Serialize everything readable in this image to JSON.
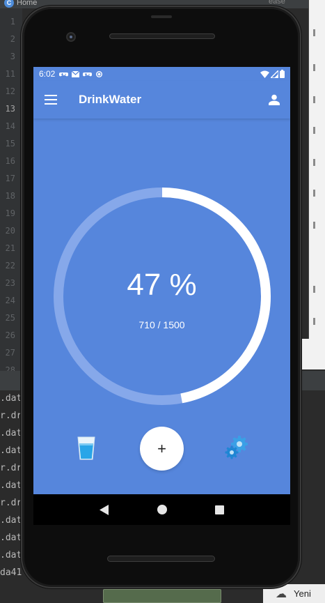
{
  "ide": {
    "tab_label": "Home",
    "right_tab_label": "ease",
    "line_numbers": [
      "1",
      "2",
      "3",
      "11",
      "12",
      "13",
      "14",
      "15",
      "16",
      "17",
      "18",
      "19",
      "20",
      "21",
      "22",
      "23",
      "24",
      "25",
      "26",
      "27",
      "28"
    ],
    "current_line": "13",
    "console_lines": [
      ".dat",
      "r.dr",
      ".dat",
      ".dat",
      "r.dr",
      ".dat",
      "r.dr",
      ".dat",
      ".dat",
      ".dat",
      "da41"
    ],
    "yeni_label": "Yeni"
  },
  "status_bar": {
    "time": "6:02",
    "icons": [
      "gamepad-icon",
      "mail-icon",
      "gamepad-icon",
      "sync-icon"
    ],
    "right_icons": [
      "wifi-icon",
      "signal-icon",
      "battery-icon"
    ]
  },
  "app_bar": {
    "title": "DrinkWater",
    "menu_icon": "hamburger-menu-icon",
    "account_icon": "account-icon"
  },
  "progress": {
    "percent_label": "47 %",
    "consumed": 710,
    "goal": 1500,
    "amount_label": "710 / 1500",
    "fraction": 0.47,
    "ring_color": "#ffffff",
    "track_color": "#86a8ea"
  },
  "actions": {
    "glass_icon": "water-glass-icon",
    "add_label": "+",
    "settings_icon": "gears-icon"
  },
  "nav": {
    "back_icon": "back-triangle-icon",
    "home_icon": "home-circle-icon",
    "recents_icon": "recents-square-icon"
  },
  "colors": {
    "screen_background": "#5686dc",
    "accent": "#ffffff"
  }
}
